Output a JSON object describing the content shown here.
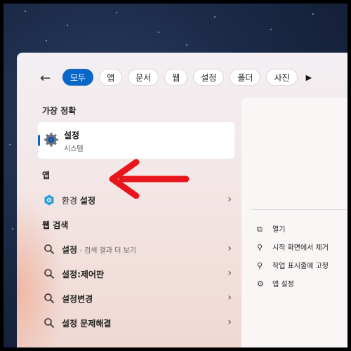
{
  "filters": {
    "back_label": "←",
    "chips": [
      "모두",
      "앱",
      "문서",
      "웹",
      "설정",
      "폴더",
      "사진"
    ],
    "more_label": "▶"
  },
  "sections": {
    "best_match": "가장 정확",
    "apps": "앱",
    "web_search": "웹 검색"
  },
  "best_match": {
    "title": "설정",
    "subtitle": "시스템"
  },
  "apps": [
    {
      "prefix": "환경 ",
      "bold": "설정"
    }
  ],
  "web_results": [
    {
      "bold": "설정",
      "suffix": " - 검색 결과 더 보기"
    },
    {
      "bold": "설정:제어판",
      "suffix": ""
    },
    {
      "bold": "설정변경",
      "suffix": ""
    },
    {
      "bold": "설정 문제해결",
      "suffix": ""
    }
  ],
  "actions": [
    {
      "icon": "open-icon",
      "label": "열기"
    },
    {
      "icon": "unpin-icon",
      "label": "시작 화면에서 제거"
    },
    {
      "icon": "pin-icon",
      "label": "작업 표시줄에 고정"
    },
    {
      "icon": "gear-icon",
      "label": "앱 설정"
    }
  ],
  "colors": {
    "accent": "#0a67c8",
    "annotation_arrow": "#e8161c"
  }
}
